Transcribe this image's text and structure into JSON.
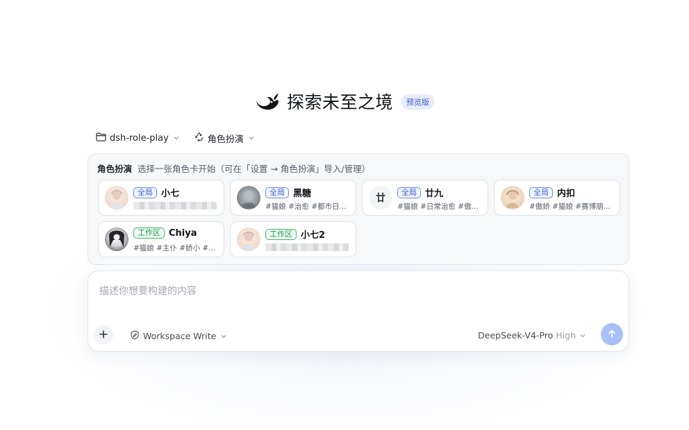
{
  "hero": {
    "title": "探索未至之境",
    "badge": "预览版",
    "logo_icon": "whale-logo-icon"
  },
  "selectors": {
    "project": {
      "label": "dsh-role-play",
      "icon": "folder-icon"
    },
    "mode": {
      "label": "角色扮演",
      "icon": "recycle-icon"
    }
  },
  "role_panel": {
    "title": "角色扮演",
    "hint": "选择一张角色卡开始（可在「设置 → 角色扮演」导入/管理）",
    "cards": [
      {
        "scope": "全局",
        "name": "小七",
        "tags": ""
      },
      {
        "scope": "全局",
        "name": "黑糖",
        "tags": "#猫娘 #治愈 #都市日..."
      },
      {
        "scope": "全局",
        "name": "廿九",
        "tags": "#猫娘 #日常治愈 #傲...",
        "avatar_text": "廿"
      },
      {
        "scope": "全局",
        "name": "内扣",
        "tags": "#傲娇 #猫娘 #赛博朋..."
      },
      {
        "scope": "工作区",
        "name": "Chiya",
        "tags": "#猫娘 #主仆 #娇小 #高..."
      },
      {
        "scope": "工作区",
        "name": "小七2",
        "tags": ""
      }
    ]
  },
  "composer": {
    "placeholder": "描述你想要构建的内容",
    "workspace_write": "Workspace Write",
    "model": "DeepSeek-V4-Pro",
    "effort": "High"
  },
  "colors": {
    "accent": "#a9c0f6",
    "global_badge": "#3d63d6",
    "workspace_badge": "#1f9a50",
    "panel_bg": "#f7f8fa"
  }
}
